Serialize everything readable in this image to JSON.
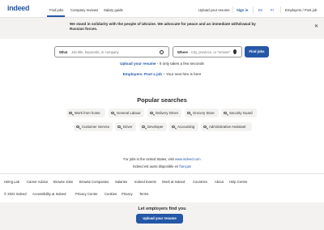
{
  "nav": {
    "logo": "indeed",
    "find_jobs": "Find jobs",
    "company_reviews": "Company reviews",
    "salary_guide": "Salary guide",
    "upload_resume": "Upload your resume",
    "sign_in": "Sign in",
    "lang_en": "En",
    "lang_fr": "Fr",
    "employers": "Employers / Post job"
  },
  "banner": {
    "text": "We stand in solidarity with the people of Ukraine. We advocate for peace and an immediate withdrawal by Russian forces.",
    "close": "✕"
  },
  "search": {
    "what_label": "What",
    "what_placeholder": "Job title, keywords, or company",
    "where_label": "Where",
    "where_placeholder": "City, province, or \"remote\"",
    "find_button": "Find jobs"
  },
  "cta": {
    "upload_link": "Upload your resume",
    "upload_rest": " - It only takes a few seconds",
    "employers_link": "Employers: Post a job",
    "employers_rest": " – Your next hire is here"
  },
  "popular": {
    "title": "Popular searches",
    "row1": [
      "Work from home",
      "General Labour",
      "Delivery Driver",
      "Grocery Store",
      "Security Guard"
    ],
    "row2": [
      "Customer Service",
      "Driver",
      "Developer",
      "Accounting",
      "Administrative Assistant"
    ]
  },
  "regional": {
    "us_text": "For jobs in the United States, visit ",
    "us_link": "www.indeed.com",
    "fr_text": "Indeed est aussi disponible en ",
    "fr_link": "français"
  },
  "footer": {
    "row1": [
      "Hiring Lab",
      "Career Advice",
      "Browse Jobs",
      "Browse Companies",
      "Salaries",
      "Indeed Events",
      "Work at Indeed",
      "Countries",
      "About",
      "Help Centre"
    ],
    "row2": [
      "© 2022 Indeed",
      "Accessibility at Indeed",
      "Privacy Centre",
      "Cookies",
      "Privacy",
      "Terms"
    ]
  },
  "employers_band": {
    "title": "Let employers find you",
    "button": "Upload your resume"
  },
  "colors": {
    "brand_blue": "#2557a7",
    "banner_bg": "#f3f2f1"
  }
}
